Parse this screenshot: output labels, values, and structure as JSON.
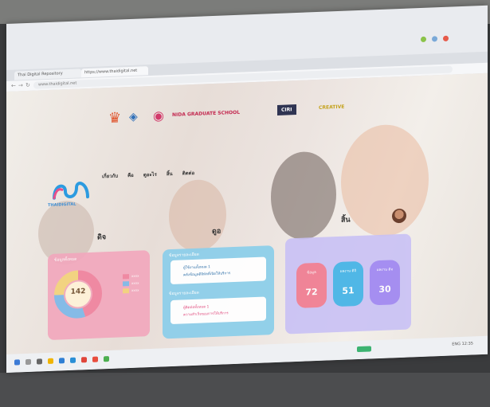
{
  "browser": {
    "tabs": [
      "Thai Digital Repository",
      "https://www.thaidigital.net"
    ],
    "url": "www.thaidigital.net"
  },
  "partners": [
    "NIDA GRADUATE SCHOOL",
    "CIRI",
    "CREATIVE"
  ],
  "brand": {
    "name": "THAIDIGITAL",
    "colors": {
      "accent": "#2c9be0"
    }
  },
  "nav": [
    "เกี่ยวกับ",
    "คือ",
    "ดูอะไร",
    "สิ้น",
    "ติดต่อ"
  ],
  "sections": {
    "left": "ดิจ",
    "middle": "ดูอ",
    "right": "สิ้น"
  },
  "donut": {
    "title": "ข้อมูลทั้งหมด",
    "center": "142",
    "slices": [
      {
        "value": 0.45,
        "color": "#f0829e"
      },
      {
        "value": 0.3,
        "color": "#7db8e8"
      },
      {
        "value": 0.25,
        "color": "#f3d27a"
      }
    ]
  },
  "legend": [
    "xxxx",
    "xxxx",
    "xxxx"
  ],
  "middle_card": {
    "title1": "ข้อมูลรายละเอียด",
    "line1": "ผู้ใช้งานทั้งหมด 1",
    "line2": "คลังข้อมูลดิจิทัลที่เปิดให้บริการ",
    "title2": "ข้อมูลรายละเอียด",
    "line3": "ผู้ติดต่อทั้งหมด 1",
    "line4": "ความสำเร็จของการให้บริการ"
  },
  "stats": [
    {
      "label": "ข้อมูล",
      "value": "72",
      "color": "#f07a8f"
    },
    {
      "label": "ผลงาน ดิจิ",
      "value": "51",
      "color": "#3fb2e6"
    },
    {
      "label": "ผลงาน ดิจ",
      "value": "30",
      "color": "#9d84f2"
    }
  ],
  "taskbar": {
    "time": "12:35",
    "lang": "ENG"
  }
}
